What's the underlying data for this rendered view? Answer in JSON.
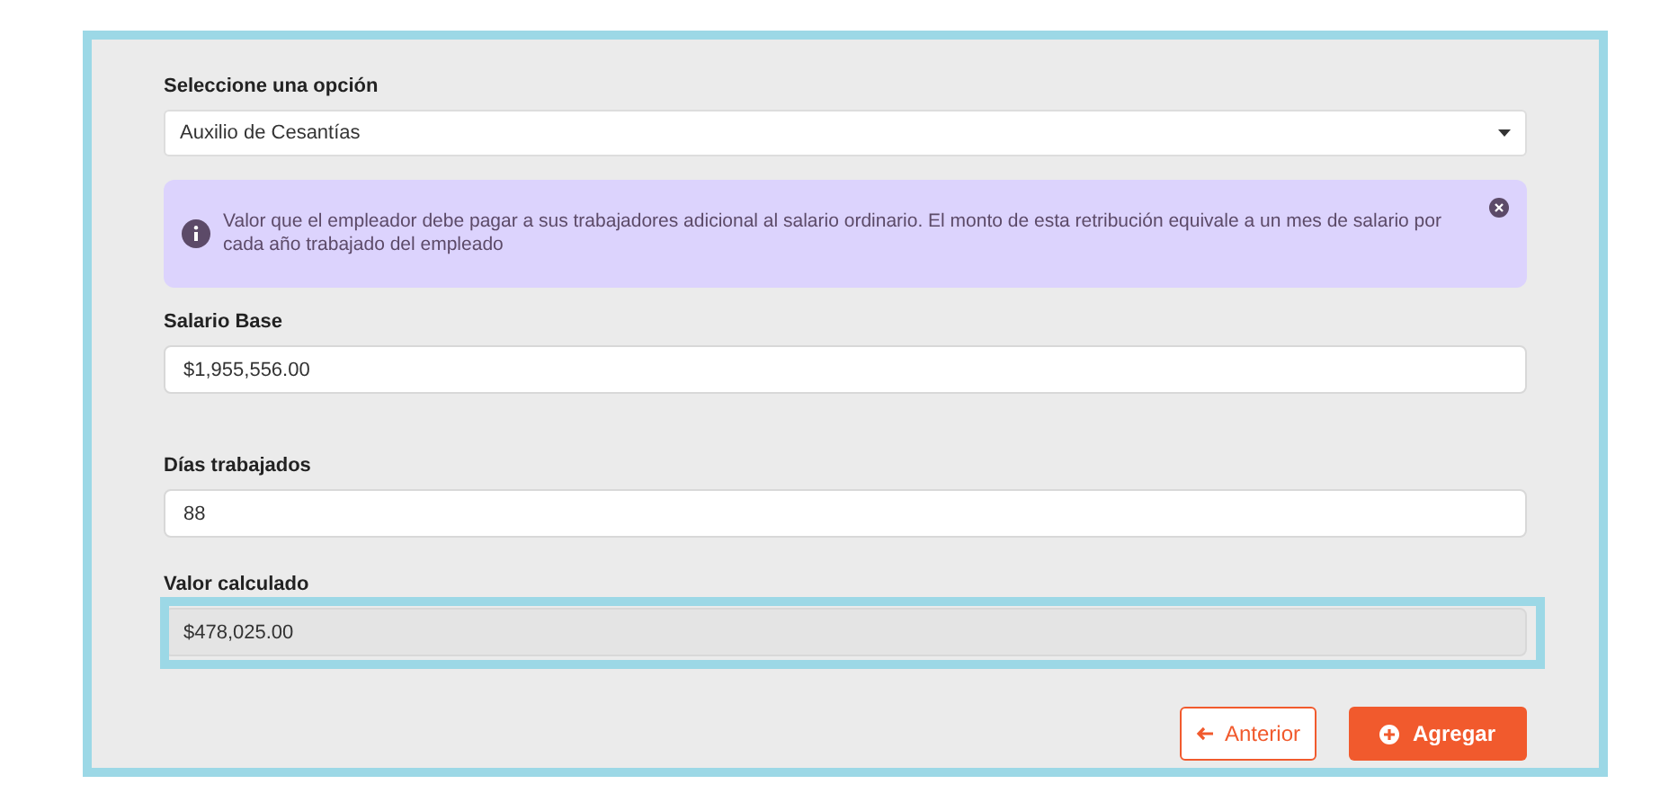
{
  "select": {
    "label": "Seleccione una opción",
    "value": "Auxilio de Cesantías"
  },
  "alert": {
    "text": "Valor que el empleador debe pagar a sus trabajadores adicional al salario ordinario. El monto de esta retribución equivale a un mes de salario por cada año trabajado del empleado"
  },
  "fields": [
    {
      "label": "Salario Base",
      "value": "$1,955,556.00",
      "readonly": false
    },
    {
      "label": "Días trabajados",
      "value": "88",
      "readonly": false
    },
    {
      "label": "Valor calculado",
      "value": "$478,025.00",
      "readonly": true,
      "highlighted": true
    }
  ],
  "buttons": [
    {
      "label": "Anterior",
      "kind": "back"
    },
    {
      "label": "Agregar",
      "kind": "add"
    }
  ]
}
